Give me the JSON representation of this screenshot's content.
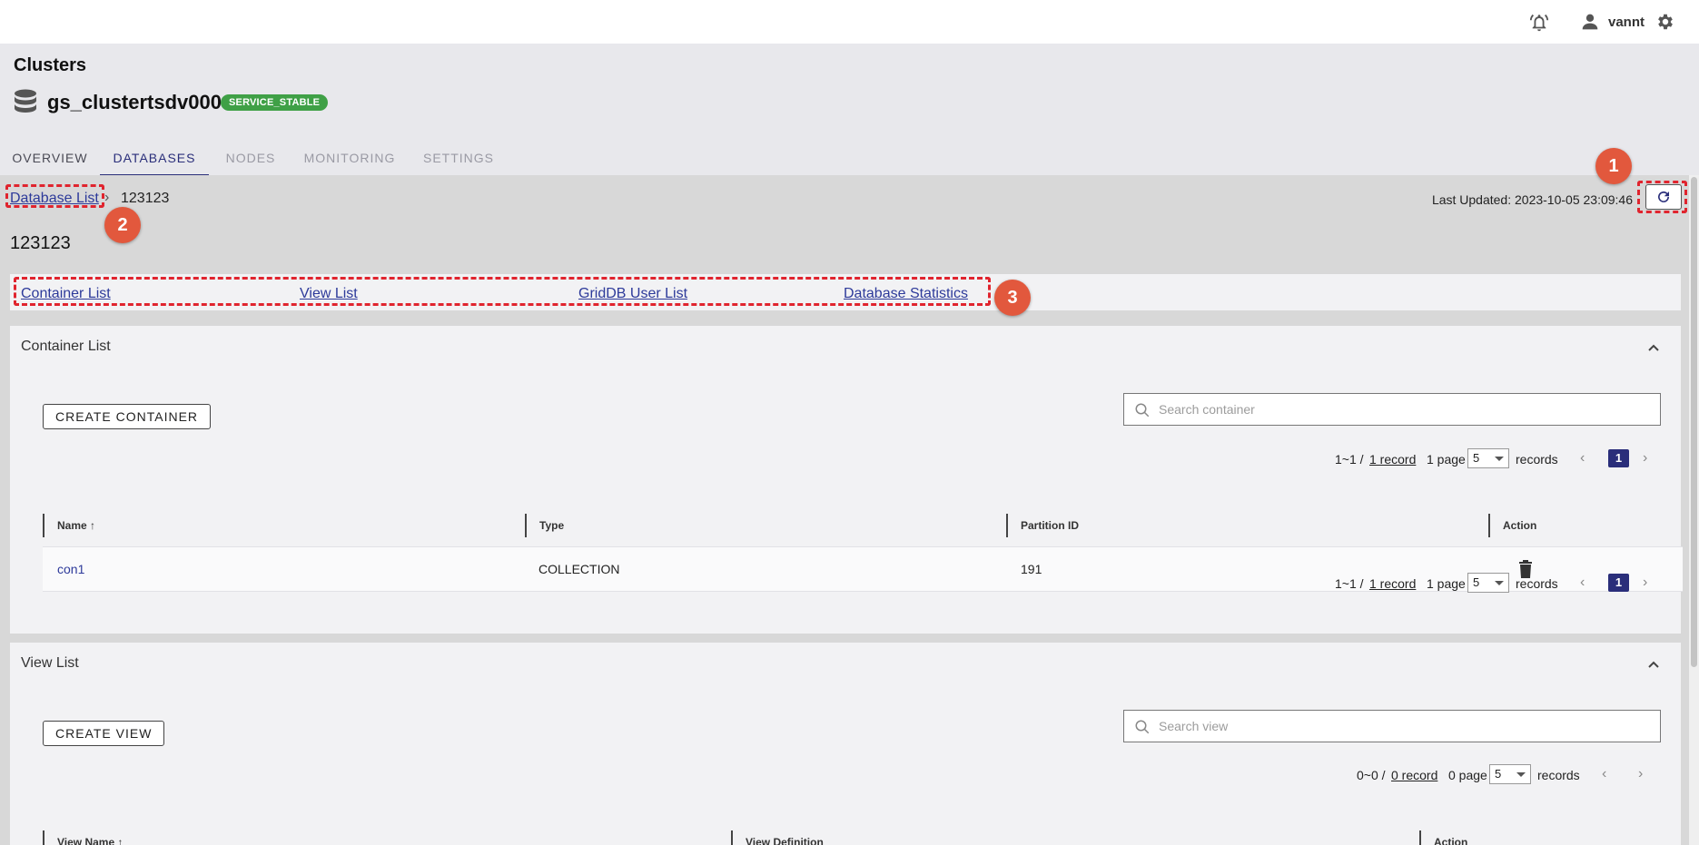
{
  "topbar": {
    "username": "vannt"
  },
  "header": {
    "page_title": "Clusters",
    "cluster_name": "gs_clustertsdv0004",
    "status_badge": "SERVICE_STABLE",
    "tabs": [
      {
        "label": "OVERVIEW",
        "state": "normal"
      },
      {
        "label": "DATABASES",
        "state": "active"
      },
      {
        "label": "NODES",
        "state": "disabled"
      },
      {
        "label": "MONITORING",
        "state": "disabled"
      },
      {
        "label": "SETTINGS",
        "state": "disabled"
      }
    ]
  },
  "breadcrumb": {
    "link": "Database List",
    "separator": "›",
    "current": "123123"
  },
  "last_updated": "Last Updated: 2023-10-05 23:09:46",
  "database_title": "123123",
  "markers": [
    "1",
    "2",
    "3"
  ],
  "section_links": [
    "Container List",
    "View List",
    "GridDB User List",
    "Database Statistics"
  ],
  "container_panel": {
    "title": "Container List",
    "create_label": "CREATE CONTAINER",
    "search_placeholder": "Search container",
    "pager": {
      "range": "1~1 /",
      "records_link": "1 record",
      "pages": "1 page",
      "page_size": "5",
      "records_label": "records",
      "current_page": "1"
    },
    "columns": [
      "Name",
      "Type",
      "Partition ID",
      "Action"
    ],
    "rows": [
      {
        "name": "con1",
        "type": "COLLECTION",
        "partition_id": "191"
      }
    ]
  },
  "view_panel": {
    "title": "View List",
    "create_label": "CREATE VIEW",
    "search_placeholder": "Search view",
    "pager": {
      "range": "0~0 /",
      "records_link": "0 record",
      "pages": "0 page",
      "page_size": "5",
      "records_label": "records"
    },
    "columns": [
      "View Name",
      "View Definition",
      "Action"
    ]
  },
  "colors": {
    "accent": "#2a2e7a",
    "link": "#2d3a9a",
    "badge": "#3fa046",
    "annotation": "#e0242e",
    "marker": "#e2583d"
  }
}
